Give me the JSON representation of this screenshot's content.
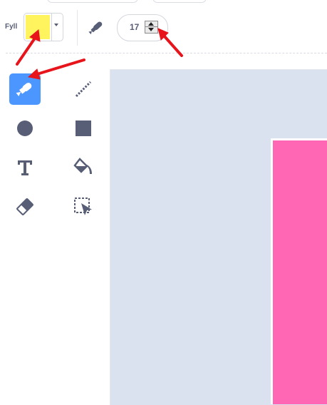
{
  "toolbar": {
    "fill_label": "Fyll",
    "fill_color": "#fff35e",
    "brush_size": "17"
  },
  "tools": [
    {
      "name": "brush",
      "icon": "brush-icon",
      "selected": true
    },
    {
      "name": "line",
      "icon": "line-icon"
    },
    {
      "name": "circle",
      "icon": "circle-icon"
    },
    {
      "name": "rectangle",
      "icon": "rectangle-icon"
    },
    {
      "name": "text",
      "icon": "text-icon"
    },
    {
      "name": "fill",
      "icon": "fill-bucket-icon"
    },
    {
      "name": "eraser",
      "icon": "eraser-icon"
    },
    {
      "name": "select",
      "icon": "select-icon"
    }
  ],
  "colors": {
    "accent": "#4c97ff",
    "canvas_bg": "#dae2f0",
    "shape": "#ff66b3",
    "annotation": "#e8141b",
    "icon": "#575e75"
  }
}
